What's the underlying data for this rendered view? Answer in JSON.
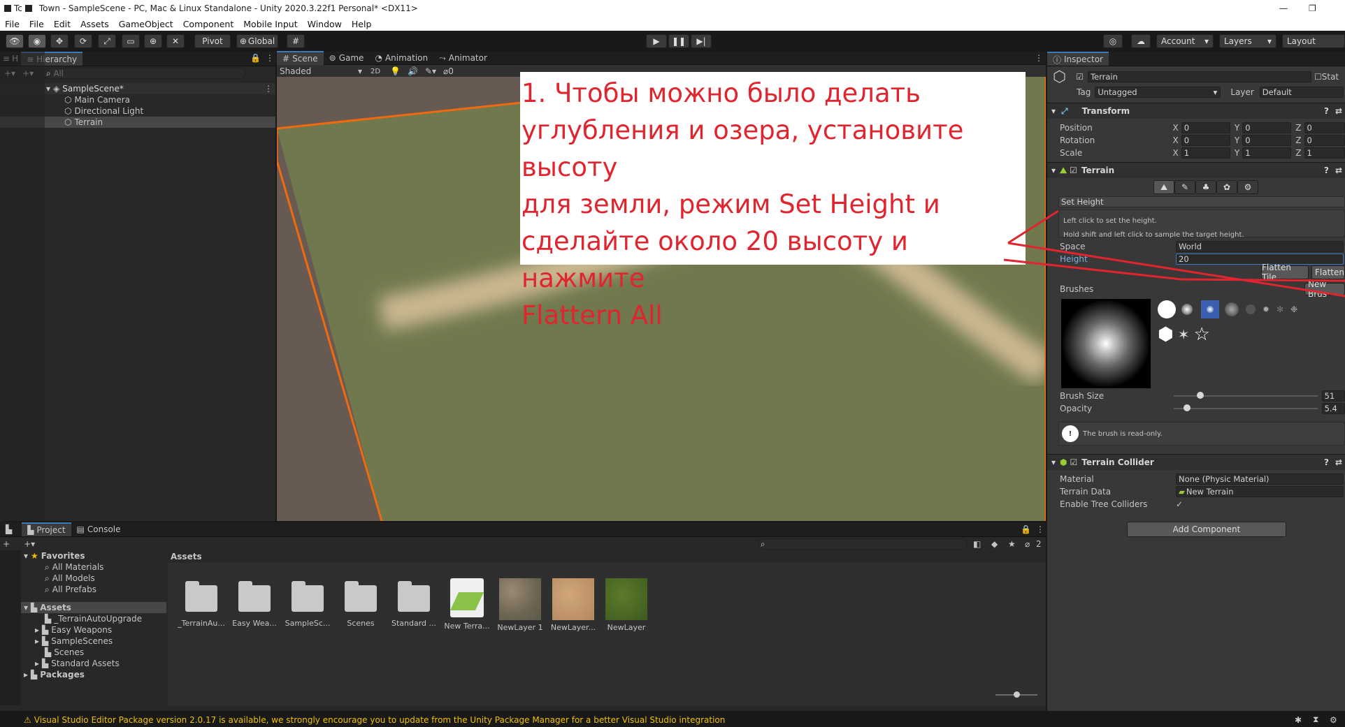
{
  "window": {
    "title": "Town - SampleScene - PC, Mac & Linux Standalone - Unity 2020.3.22f1 Personal* <DX11>",
    "tab_title": "Tc",
    "minimize": "—",
    "restore": "❐"
  },
  "menu": [
    "File",
    "File",
    "Edit",
    "Assets",
    "GameObject",
    "Component",
    "Mobile Input",
    "Window",
    "Help"
  ],
  "toolbar": {
    "pivot": "Pivot",
    "global": "Global",
    "account": "Account",
    "layers": "Layers",
    "layout": "Layout"
  },
  "hierarchy": {
    "tab_h": "H",
    "tab": "Hierarchy",
    "search_placeholder": "All",
    "scene": "SampleScene*",
    "items": [
      "Main Camera",
      "Directional Light",
      "Terrain"
    ]
  },
  "scene_view": {
    "tabs": [
      "Scene",
      "Game",
      "Animation",
      "Animator"
    ],
    "shading": "Shaded",
    "mode_2d": "2D",
    "hidden_count": "0",
    "gizmos": "Gizmos",
    "search_placeholder": "All"
  },
  "annotation": {
    "lines": [
      "1. Чтобы можно было делать",
      "углубления и озера, установите высоту",
      "для земли, режим Set Height и",
      "сделайте около 20 высоту и нажмите",
      "Flattern All"
    ]
  },
  "inspector": {
    "tab": "Inspector",
    "object_name": "Terrain",
    "static_label": "Stat",
    "tag_label": "Tag",
    "tag_value": "Untagged",
    "layer_label": "Layer",
    "layer_value": "Default",
    "transform": {
      "title": "Transform",
      "rows": [
        {
          "label": "Position",
          "x": "0",
          "y": "0",
          "z": "0"
        },
        {
          "label": "Rotation",
          "x": "0",
          "y": "0",
          "z": "0"
        },
        {
          "label": "Scale",
          "x": "1",
          "y": "1",
          "z": "1"
        }
      ]
    },
    "terrain": {
      "title": "Terrain",
      "tool_mode": "Set Height",
      "help_line1": "Left click to set the height.",
      "help_line2": "Hold shift and left click to sample the target height.",
      "space_label": "Space",
      "space_value": "World",
      "height_label": "Height",
      "height_value": "20",
      "flatten_tile": "Flatten Tile",
      "flatten_all": "Flatten",
      "brushes_label": "Brushes",
      "new_brush": "New Brus",
      "brush_size_label": "Brush Size",
      "brush_size_value": "51",
      "brush_size_fraction": 0.16,
      "opacity_label": "Opacity",
      "opacity_value": "5.4",
      "opacity_fraction": 0.07,
      "readonly_msg": "The brush is read-only."
    },
    "collider": {
      "title": "Terrain Collider",
      "material_label": "Material",
      "material_value": "None (Physic Material)",
      "data_label": "Terrain Data",
      "data_value": "New Terrain",
      "trees_label": "Enable Tree Colliders"
    },
    "add_component": "Add Component"
  },
  "project": {
    "tabs": [
      "Project",
      "Console"
    ],
    "hidden_count": "2",
    "favorites_label": "Favorites",
    "favorites": [
      "All Materials",
      "All Models",
      "All Prefabs"
    ],
    "assets_label": "Assets",
    "asset_folders": [
      "_TerrainAutoUpgrade",
      "Easy Weapons",
      "SampleScenes",
      "Scenes",
      "Standard Assets"
    ],
    "packages_label": "Packages",
    "breadcrumb": "Assets",
    "grid": [
      {
        "label": "_TerrainAu...",
        "kind": "folder"
      },
      {
        "label": "Easy Wea...",
        "kind": "folder"
      },
      {
        "label": "SampleSc...",
        "kind": "folder"
      },
      {
        "label": "Scenes",
        "kind": "folder"
      },
      {
        "label": "Standard ...",
        "kind": "folder"
      },
      {
        "label": "New Terra...",
        "kind": "terrain"
      },
      {
        "label": "NewLayer 1",
        "kind": "layer1"
      },
      {
        "label": "NewLayer...",
        "kind": "layer2"
      },
      {
        "label": "NewLayer",
        "kind": "layer3"
      }
    ]
  },
  "status": {
    "message": "Visual Studio Editor Package version 2.0.17 is available, we strongly encourage you to update from the Unity Package Manager for a better Visual Studio integration"
  },
  "colors": {
    "annotation_red": "#e1252f",
    "selection_orange": "#f26a10",
    "terrain_green": "#6e7a4a",
    "warning_yellow": "#f0c000"
  }
}
